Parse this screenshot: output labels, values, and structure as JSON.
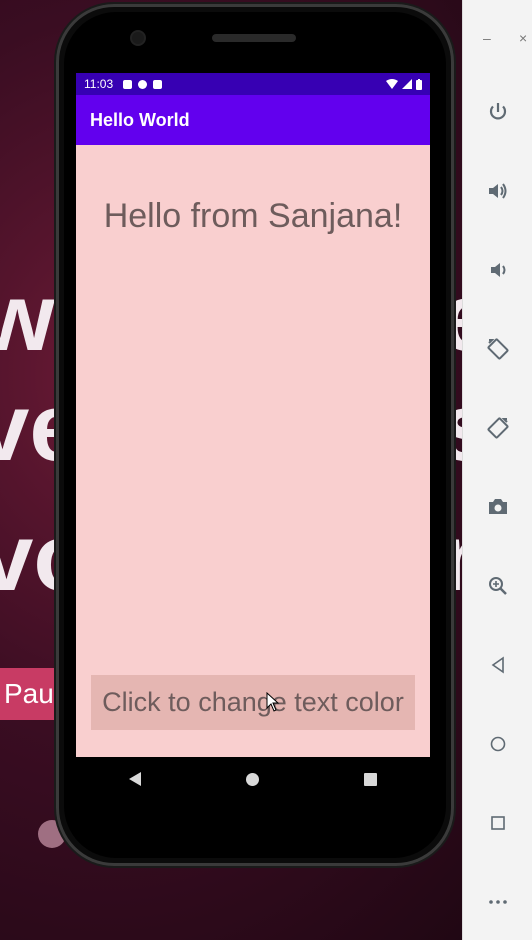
{
  "background": {
    "fragments": [
      "wa",
      "ve",
      "vo"
    ],
    "right_fragments": [
      "e",
      "s",
      "n"
    ],
    "pill_text": "Pau"
  },
  "status_bar": {
    "time": "11:03"
  },
  "app": {
    "title": "Hello World",
    "message": "Hello from Sanjana!",
    "button_label": "Click to change text color"
  },
  "colors": {
    "screen_bg": "#f9cfcf",
    "app_bar": "#6200ee",
    "status_bar": "#3700b3",
    "text": "#6e5c5c",
    "button_bg": "#e5b6b2"
  },
  "emulator_panel": {
    "window_minimize": "–",
    "window_close": "×",
    "tools": [
      {
        "icon": "power-icon"
      },
      {
        "icon": "volume-up-icon"
      },
      {
        "icon": "volume-down-icon"
      },
      {
        "icon": "rotate-left-icon"
      },
      {
        "icon": "rotate-right-icon"
      },
      {
        "icon": "camera-icon"
      },
      {
        "icon": "zoom-icon"
      },
      {
        "icon": "back-icon"
      },
      {
        "icon": "home-icon"
      },
      {
        "icon": "overview-icon"
      },
      {
        "icon": "more-icon"
      }
    ]
  }
}
